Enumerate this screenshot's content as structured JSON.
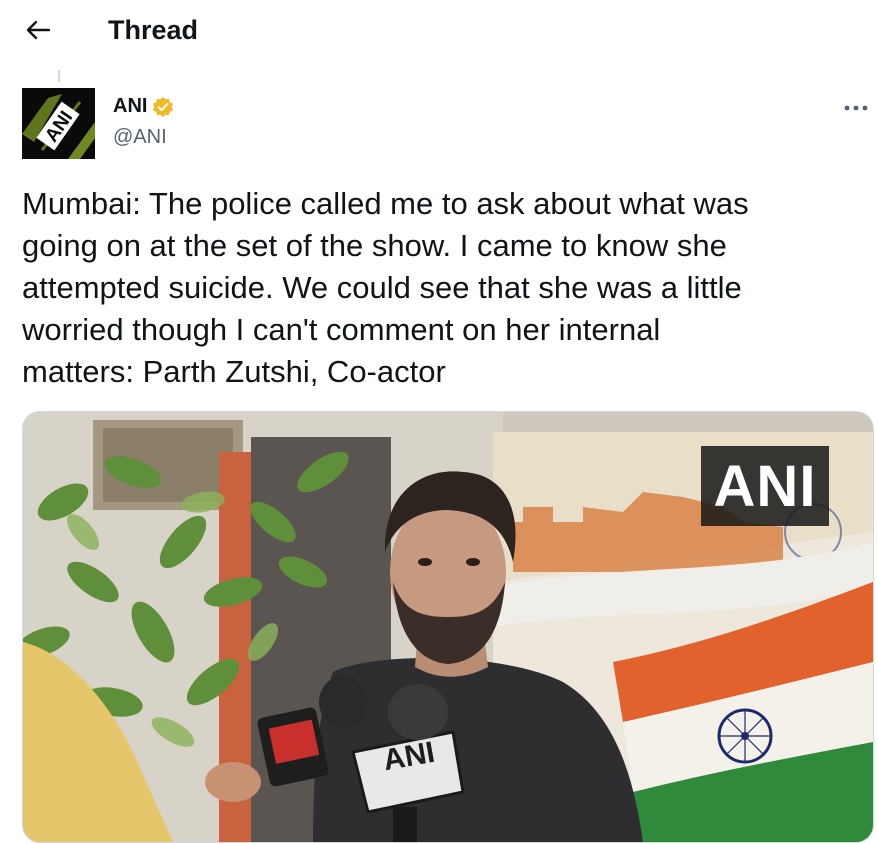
{
  "header": {
    "title": "Thread"
  },
  "author": {
    "name": "ANI",
    "handle": "@ANI",
    "avatar_text": "ANI",
    "verified_color": "#f2b826"
  },
  "tweet": {
    "text": "Mumbai: The police called me to ask about what was\ngoing on at the set of the show. I came to know she\nattempted suicide. We could see that she was a little\nworried though I can't comment on her internal\nmatters: Parth Zutshi, Co-actor"
  },
  "media": {
    "watermark": "ANI",
    "mic_label": "ANI"
  },
  "colors": {
    "text": "#0f1419",
    "secondary": "#536471",
    "border": "#cfd9de"
  },
  "icons": [
    "arrow-left-icon",
    "verified-badge-icon",
    "more-icon"
  ]
}
